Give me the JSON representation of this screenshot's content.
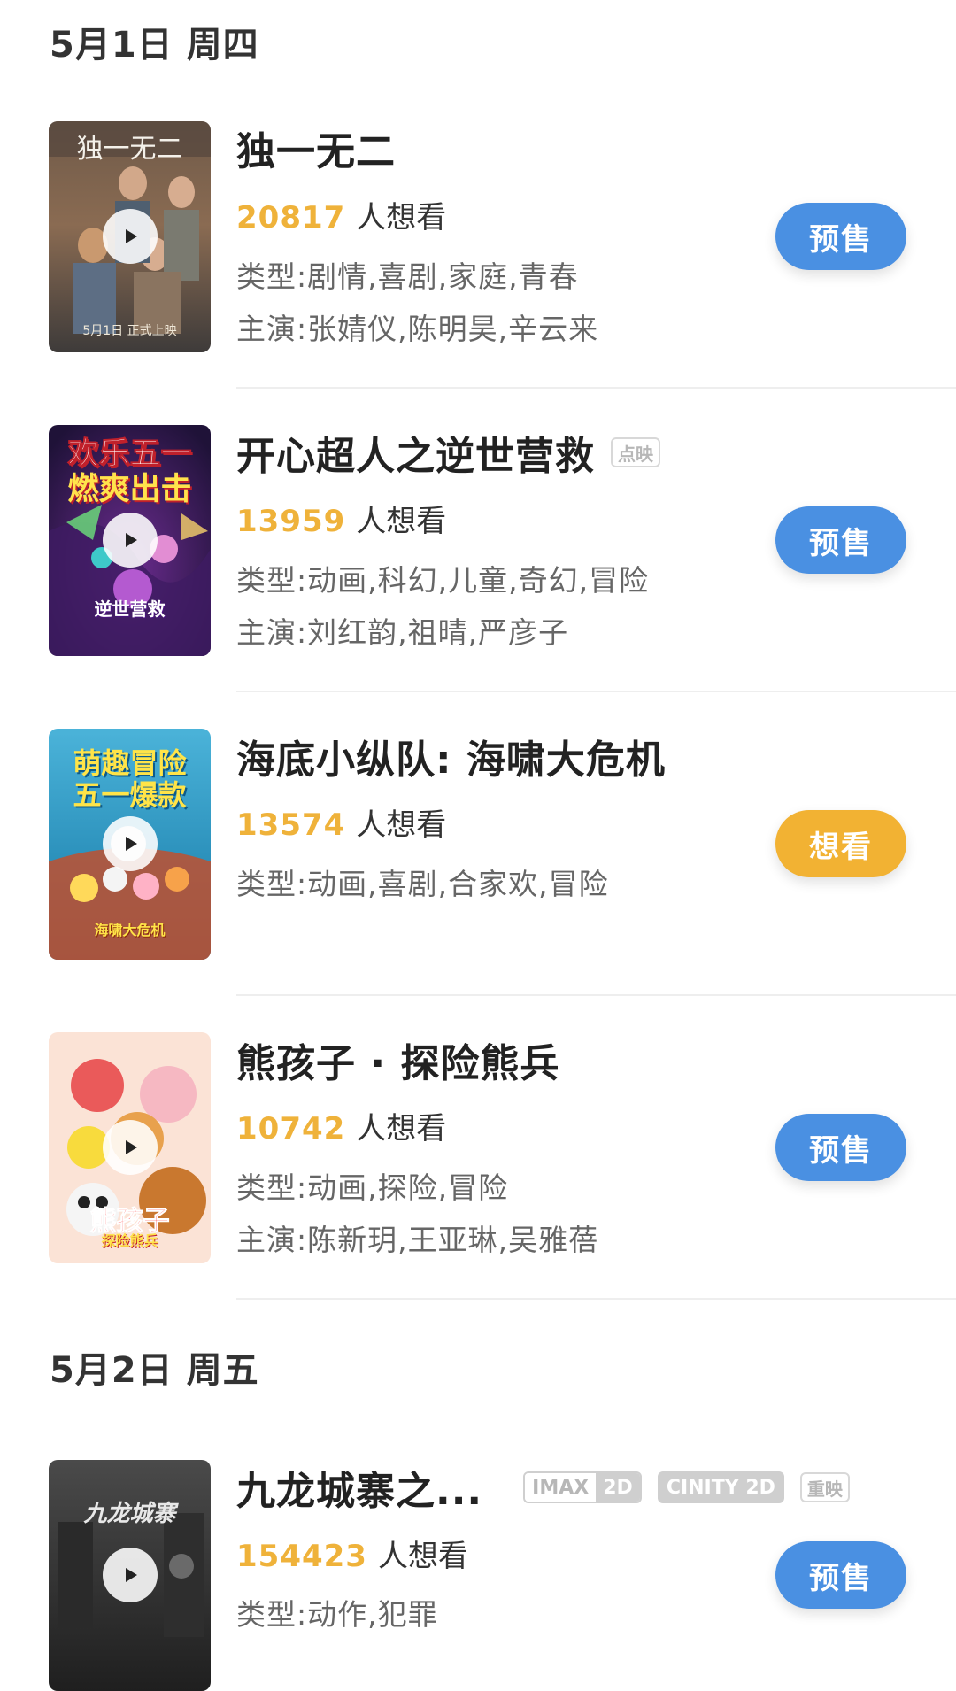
{
  "sections": [
    {
      "date_label": "5月1日 周四",
      "movies": [
        {
          "title": "独一无二",
          "want_count": "20817",
          "want_suffix": "人想看",
          "genre": "类型:剧情,喜剧,家庭,青春",
          "cast": "主演:张婧仪,陈明昊,辛云来",
          "action_label": "预售",
          "poster_text": "独一无二",
          "poster_subtext": "5月1日 正式上映"
        },
        {
          "title": "开心超人之逆世营救",
          "tag": "点映",
          "want_count": "13959",
          "want_suffix": "人想看",
          "genre": "类型:动画,科幻,儿童,奇幻,冒险",
          "cast": "主演:刘红韵,祖晴,严彦子",
          "action_label": "预售",
          "poster_text": "欢乐五一",
          "poster_text2": "燃爽出击",
          "poster_subtext": "逆世营救"
        },
        {
          "title": "海底小纵队: 海啸大危机",
          "want_count": "13574",
          "want_suffix": "人想看",
          "genre": "类型:动画,喜剧,合家欢,冒险",
          "action_label": "想看",
          "poster_text": "萌趣冒险",
          "poster_text2": "五一爆款",
          "poster_subtext": "海啸大危机"
        },
        {
          "title": "熊孩子 · 探险熊兵",
          "want_count": "10742",
          "want_suffix": "人想看",
          "genre": "类型:动画,探险,冒险",
          "cast": "主演:陈新玥,王亚琳,吴雅蓓",
          "action_label": "预售",
          "poster_text": "熊孩子",
          "poster_subtext": "探险熊兵"
        }
      ]
    },
    {
      "date_label": "5月2日 周五",
      "movies": [
        {
          "title": "九龙城寨之...",
          "tags": [
            "IMAX",
            "2D",
            "CINITY 2D",
            "重映"
          ],
          "want_count": "154423",
          "want_suffix": "人想看",
          "genre": "类型:动作,犯罪",
          "action_label": "预售",
          "poster_text": "九龙城寨"
        }
      ]
    }
  ],
  "colors": {
    "want_count": "#efb23a",
    "presale_button": "#4a90e2",
    "want_button": "#f2b233"
  },
  "icons": {
    "play": "play-icon"
  }
}
